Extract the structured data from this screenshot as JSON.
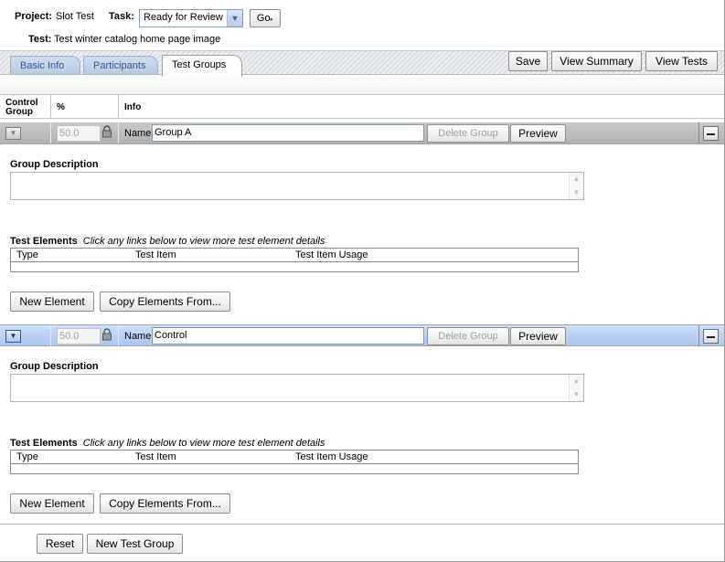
{
  "header": {
    "project_label": "Project:",
    "project_value": "Slot Test",
    "task_label": "Task:",
    "task_value": "Ready for Review",
    "go_label": "Go",
    "test_label": "Test:",
    "test_value": "Test winter catalog home page image"
  },
  "tabs": [
    {
      "label": "Basic Info"
    },
    {
      "label": "Participants"
    },
    {
      "label": "Test Groups"
    }
  ],
  "toolbar": {
    "save_label": "Save",
    "view_summary_label": "View Summary",
    "view_tests_label": "View Tests"
  },
  "columns": {
    "control_group": "Control Group",
    "percent": "%",
    "info": "Info"
  },
  "groups": [
    {
      "percent": "50.0",
      "name_label": "Name:",
      "name": "Group A",
      "delete_label": "Delete Group",
      "preview_label": "Preview",
      "description_label": "Group Description",
      "test_elements_label": "Test Elements",
      "test_elements_hint": "Click any links below to view more test element details",
      "table_headers": [
        "Type",
        "Test Item",
        "Test Item Usage"
      ],
      "new_element_label": "New Element",
      "copy_elements_label": "Copy Elements From..."
    },
    {
      "percent": "50.0",
      "name_label": "Name:",
      "name": "Control",
      "delete_label": "Delete Group",
      "preview_label": "Preview",
      "description_label": "Group Description",
      "test_elements_label": "Test Elements",
      "test_elements_hint": "Click any links below to view more test element details",
      "table_headers": [
        "Type",
        "Test Item",
        "Test Item Usage"
      ],
      "new_element_label": "New Element",
      "copy_elements_label": "Copy Elements From..."
    }
  ],
  "footer": {
    "reset_label": "Reset",
    "new_test_group_label": "New Test Group"
  },
  "colors": {
    "row_gray": "#b9b9b9",
    "row_blue": "#b8d0f6",
    "tab_text": "#33559a"
  }
}
